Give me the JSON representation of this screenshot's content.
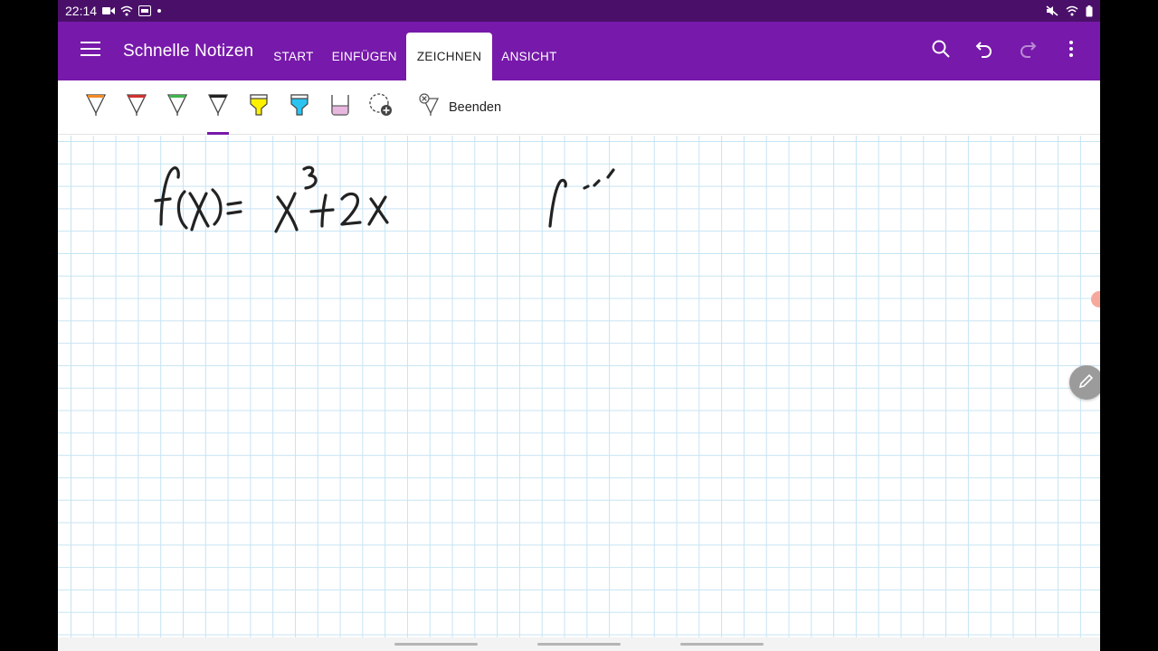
{
  "status_bar": {
    "time": "22:14",
    "left_icons": [
      "video-icon",
      "wifi-icon",
      "news-app-icon",
      "dot-icon"
    ],
    "right_icons": [
      "mute-icon",
      "wifi-icon",
      "battery-icon"
    ]
  },
  "app_bar": {
    "title": "Schnelle Notizen",
    "tabs": [
      {
        "label": "START",
        "active": false
      },
      {
        "label": "EINFÜGEN",
        "active": false
      },
      {
        "label": "ZEICHNEN",
        "active": true
      },
      {
        "label": "ANSICHT",
        "active": false
      }
    ],
    "actions": [
      "search-icon",
      "undo-icon",
      "redo-icon",
      "more-icon"
    ]
  },
  "toolbar": {
    "pens": [
      {
        "name": "pen-orange",
        "color": "#f08a24",
        "kind": "pen"
      },
      {
        "name": "pen-red",
        "color": "#d32f2f",
        "kind": "pen"
      },
      {
        "name": "pen-green",
        "color": "#3fb34f",
        "kind": "pen"
      },
      {
        "name": "pen-black",
        "color": "#222222",
        "kind": "pen",
        "selected": true
      },
      {
        "name": "highlighter-yellow",
        "color": "#fff200",
        "kind": "highlighter"
      },
      {
        "name": "highlighter-cyan",
        "color": "#2bc4f0",
        "kind": "highlighter"
      },
      {
        "name": "highlighter-pink",
        "color": "#e8b7e0",
        "kind": "marker"
      }
    ],
    "add_pen_icon": "add-pen-icon",
    "finish_label": "Beenden"
  },
  "colors": {
    "accent": "#7719aa",
    "status_bar": "#4a1069",
    "grid": "#c6e4f3",
    "ink": "#222222"
  }
}
